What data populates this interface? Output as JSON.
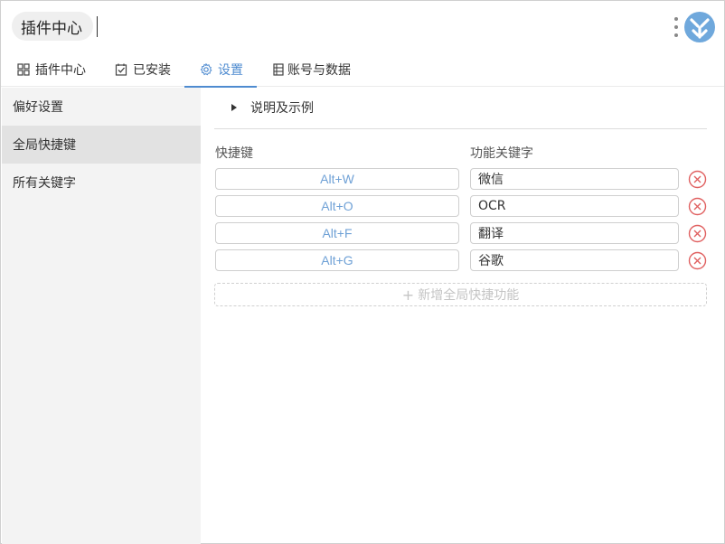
{
  "header": {
    "title": "插件中心",
    "icons": {
      "more": "more-vertical-icon",
      "logo": "app-logo-icon"
    },
    "logo_color": "#6fa8dc"
  },
  "tabs": [
    {
      "label": "插件中心",
      "icon": "grid-icon",
      "active": false
    },
    {
      "label": "已安装",
      "icon": "checkbox-icon",
      "active": false
    },
    {
      "label": "设置",
      "icon": "gear-icon",
      "active": true
    },
    {
      "label": "账号与数据",
      "icon": "database-icon",
      "active": false
    }
  ],
  "sidebar": {
    "items": [
      {
        "label": "偏好设置",
        "active": false
      },
      {
        "label": "全局快捷键",
        "active": true
      },
      {
        "label": "所有关键字",
        "active": false
      }
    ]
  },
  "main": {
    "explain_label": "说明及示例",
    "col_shortcut": "快捷键",
    "col_keyword": "功能关键字",
    "rows": [
      {
        "shortcut": "Alt+W",
        "keyword": "微信"
      },
      {
        "shortcut": "Alt+O",
        "keyword": "OCR"
      },
      {
        "shortcut": "Alt+F",
        "keyword": "翻译"
      },
      {
        "shortcut": "Alt+G",
        "keyword": "谷歌"
      }
    ],
    "add_label": "新增全局快捷功能"
  },
  "colors": {
    "accent": "#4e8bd0",
    "shortcut_text": "#6fa1d6",
    "delete_red": "#e06060",
    "sidebar_bg": "#f3f3f3",
    "sidebar_active": "#e2e2e2"
  }
}
